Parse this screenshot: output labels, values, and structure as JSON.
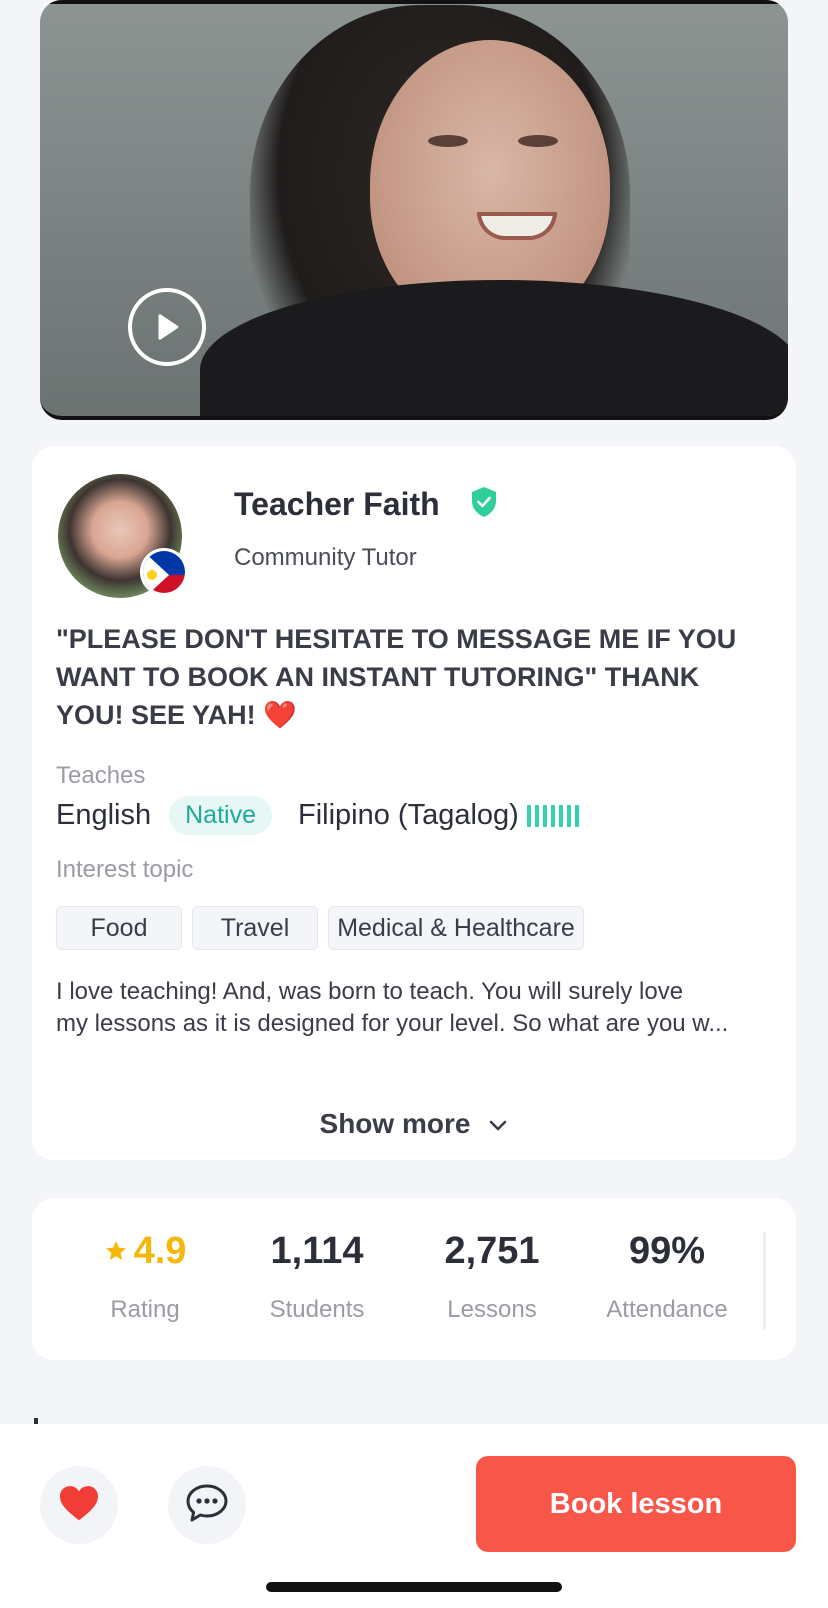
{
  "video": {
    "play_icon": "play-icon"
  },
  "profile": {
    "name": "Teacher Faith",
    "verified_icon": "verified-shield-icon",
    "role": "Community Tutor",
    "flag_icon": "philippines-flag-icon",
    "headline": "\"PLEASE DON'T HESITATE TO MESSAGE ME IF YOU WANT TO BOOK AN INSTANT TUTORING\" THANK YOU! SEE YAH! ❤️",
    "teaches_label": "Teaches",
    "languages": [
      {
        "name": "English",
        "level": "Native"
      },
      {
        "name": "Filipino (Tagalog)",
        "level_icon": "proficiency-bars-icon"
      }
    ],
    "interest_label": "Interest topic",
    "topics": [
      "Food",
      "Travel",
      "Medical & Healthcare"
    ],
    "bio_line1": "I love teaching!  And,  was born to teach. You will surely love",
    "bio_line2": "my lessons as it is designed for your level. So what are you w...",
    "show_more": "Show more"
  },
  "stats": {
    "rating": {
      "value": "4.9",
      "label": "Rating"
    },
    "students": {
      "value": "1,114",
      "label": "Students"
    },
    "lessons": {
      "value": "2,751",
      "label": "Lessons"
    },
    "attendance": {
      "value": "99%",
      "label": "Attendance"
    }
  },
  "actions": {
    "favorite_icon": "heart-icon",
    "message_icon": "chat-bubble-icon",
    "book_label": "Book lesson"
  },
  "colors": {
    "accent": "#f9564a",
    "verified": "#2fcf9a",
    "rating": "#f5b70a",
    "native_tag": "#1faa9a"
  }
}
